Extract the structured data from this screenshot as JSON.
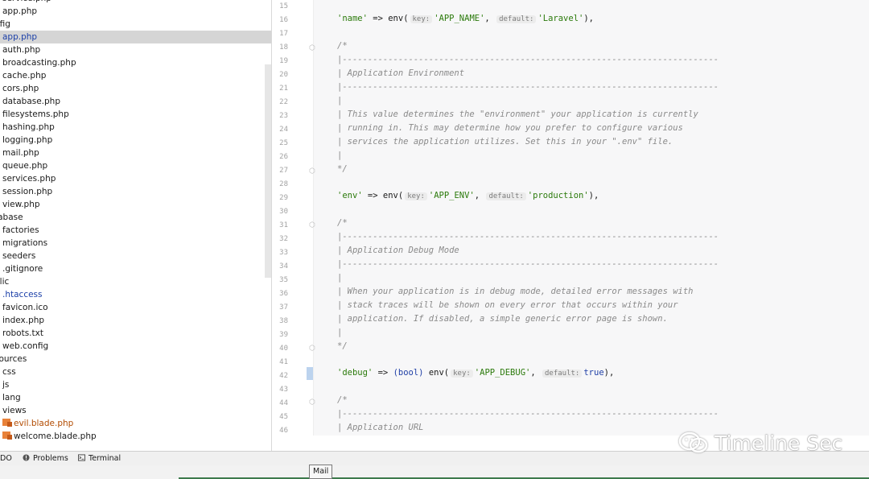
{
  "tree": [
    {
      "label": "service.php",
      "depth": 1,
      "style": "",
      "cut": true
    },
    {
      "label": "app.php",
      "depth": 1,
      "style": ""
    },
    {
      "label": "nfig",
      "depth": 0,
      "style": ""
    },
    {
      "label": "app.php",
      "depth": 1,
      "style": "selected"
    },
    {
      "label": "auth.php",
      "depth": 1,
      "style": ""
    },
    {
      "label": "broadcasting.php",
      "depth": 1,
      "style": ""
    },
    {
      "label": "cache.php",
      "depth": 1,
      "style": ""
    },
    {
      "label": "cors.php",
      "depth": 1,
      "style": ""
    },
    {
      "label": "database.php",
      "depth": 1,
      "style": ""
    },
    {
      "label": "filesystems.php",
      "depth": 1,
      "style": ""
    },
    {
      "label": "hashing.php",
      "depth": 1,
      "style": ""
    },
    {
      "label": "logging.php",
      "depth": 1,
      "style": ""
    },
    {
      "label": "mail.php",
      "depth": 1,
      "style": ""
    },
    {
      "label": "queue.php",
      "depth": 1,
      "style": ""
    },
    {
      "label": "services.php",
      "depth": 1,
      "style": ""
    },
    {
      "label": "session.php",
      "depth": 1,
      "style": ""
    },
    {
      "label": "view.php",
      "depth": 1,
      "style": ""
    },
    {
      "label": "tabase",
      "depth": 0,
      "style": ""
    },
    {
      "label": "factories",
      "depth": 1,
      "style": ""
    },
    {
      "label": "migrations",
      "depth": 1,
      "style": ""
    },
    {
      "label": "seeders",
      "depth": 1,
      "style": ""
    },
    {
      "label": ".gitignore",
      "depth": 1,
      "style": ""
    },
    {
      "label": "blic",
      "depth": 0,
      "style": ""
    },
    {
      "label": ".htaccess",
      "depth": 1,
      "style": "blue"
    },
    {
      "label": "favicon.ico",
      "depth": 1,
      "style": ""
    },
    {
      "label": "index.php",
      "depth": 1,
      "style": ""
    },
    {
      "label": "robots.txt",
      "depth": 1,
      "style": ""
    },
    {
      "label": "web.config",
      "depth": 1,
      "style": ""
    },
    {
      "label": "sources",
      "depth": 0,
      "style": ""
    },
    {
      "label": "css",
      "depth": 1,
      "style": ""
    },
    {
      "label": "js",
      "depth": 1,
      "style": ""
    },
    {
      "label": "lang",
      "depth": 1,
      "style": ""
    },
    {
      "label": "views",
      "depth": 1,
      "style": ""
    },
    {
      "label": "evil.blade.php",
      "depth": 1,
      "style": "orange",
      "icon": true
    },
    {
      "label": "welcome.blade.php",
      "depth": 1,
      "style": "",
      "icon": true
    }
  ],
  "editor": {
    "line_numbers": [
      "15",
      "16",
      "17",
      "18",
      "19",
      "20",
      "21",
      "22",
      "23",
      "24",
      "25",
      "26",
      "27",
      "28",
      "29",
      "30",
      "31",
      "32",
      "33",
      "34",
      "35",
      "36",
      "37",
      "38",
      "39",
      "40",
      "41",
      "42",
      "43",
      "44",
      "45",
      "46"
    ],
    "comment_dashes": "|--------------------------------------------------------------------------",
    "lines": {
      "l16": {
        "k": "'name'",
        "op": " => env(",
        "hint_key": "key:",
        "v1": "'APP_NAME'",
        "sep": ",",
        "hint_def": "default:",
        "v2": "'Laravel'",
        "end": "),"
      },
      "l18": "/*",
      "l20": "| Application Environment",
      "l22": "|",
      "l23": "| This value determines the \"environment\" your application is currently",
      "l24": "| running in. This may determine how you prefer to configure various",
      "l25": "| services the application utilizes. Set this in your \".env\" file.",
      "l26": "|",
      "l27": "*/",
      "l29": {
        "k": "'env'",
        "op": " => env(",
        "hint_key": "key:",
        "v1": "'APP_ENV'",
        "sep": ",",
        "hint_def": "default:",
        "v2": "'production'",
        "end": "),"
      },
      "l31": "/*",
      "l33": "| Application Debug Mode",
      "l35": "|",
      "l36": "| When your application is in debug mode, detailed error messages with",
      "l37": "| stack traces will be shown on every error that occurs within your",
      "l38": "| application. If disabled, a simple generic error page is shown.",
      "l39": "|",
      "l40": "*/",
      "l42": {
        "k": "'debug'",
        "op": " => ",
        "kw": "(bool)",
        "op2": " env(",
        "hint_key": "key:",
        "v1": "'APP_DEBUG'",
        "sep": ",",
        "hint_def": "default:",
        "v2": "true",
        "end": "),"
      },
      "l44": "/*",
      "l46": "| Application URL"
    }
  },
  "toolbar": {
    "todo": "DO",
    "problems": "Problems",
    "terminal": "Terminal"
  },
  "tooltip": "Mail",
  "watermark": "Timeline Sec",
  "colors": {
    "selection": "#d5d5d5",
    "string": "#2b7a0b",
    "comment": "#8a8a8a",
    "keyword": "#1f3fa6"
  }
}
